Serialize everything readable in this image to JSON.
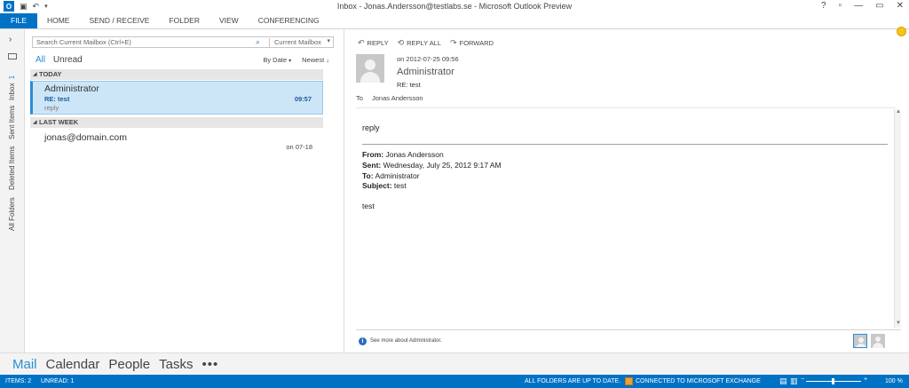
{
  "window": {
    "title": "Inbox - Jonas.Andersson@testlabs.se - Microsoft Outlook Preview",
    "app_logo": "O",
    "controls": [
      "?",
      "▫",
      "—",
      "▭",
      "✕"
    ]
  },
  "ribbon": {
    "tabs": [
      "FILE",
      "HOME",
      "SEND / RECEIVE",
      "FOLDER",
      "VIEW",
      "CONFERENCING"
    ]
  },
  "rail": {
    "expand_glyph": "›",
    "folders": [
      {
        "label": "Inbox",
        "count": "1"
      },
      {
        "label": "Sent Items"
      },
      {
        "label": "Deleted Items"
      },
      {
        "label": "All Folders"
      }
    ]
  },
  "search": {
    "placeholder": "Search Current Mailbox (Ctrl+E)",
    "scope": "Current Mailbox",
    "icon": "search-icon"
  },
  "filters": {
    "all": "All",
    "unread": "Unread"
  },
  "sort": {
    "by": "By Date",
    "order": "Newest"
  },
  "groups": {
    "today": "TODAY",
    "last_week": "LAST WEEK"
  },
  "messages": [
    {
      "from": "Administrator",
      "subject": "RE: test",
      "preview": "reply",
      "time": "09:57"
    },
    {
      "from": "jonas@domain.com",
      "date": "on 07-18"
    }
  ],
  "reading": {
    "actions": {
      "reply": "REPLY",
      "reply_all": "REPLY ALL",
      "forward": "FORWARD"
    },
    "date": "on 2012-07-25 09:56",
    "from": "Administrator",
    "subject": "RE: test",
    "to_label": "To",
    "to": "Jonas Andersson",
    "body_reply": "reply",
    "orig_from_label": "From:",
    "orig_from": "Jonas Andersson",
    "orig_sent_label": "Sent:",
    "orig_sent": "Wednesday, July 25, 2012 9:17 AM",
    "orig_to_label": "To:",
    "orig_to": "Administrator",
    "orig_subject_label": "Subject:",
    "orig_subject": "test",
    "orig_body": "test",
    "people_pane": "See more about Administrator."
  },
  "navbar": {
    "items": [
      "Mail",
      "Calendar",
      "People",
      "Tasks"
    ],
    "more": "•••"
  },
  "status": {
    "items": "ITEMS: 2",
    "unread": "UNREAD: 1",
    "folders": "ALL FOLDERS ARE UP TO DATE.",
    "connection": "CONNECTED TO MICROSOFT EXCHANGE",
    "zoom": "100 %",
    "zoom_minus": "−",
    "zoom_plus": "+"
  },
  "colors": {
    "accent": "#0072c6",
    "selected_bg": "#cde6f7",
    "link": "#2a8dd4"
  }
}
